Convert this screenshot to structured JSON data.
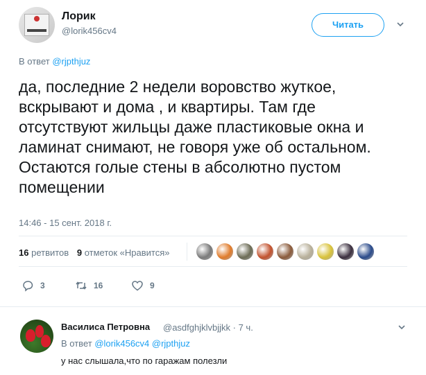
{
  "tweet": {
    "author_name": "Лорик",
    "author_handle": "@lorik456cv4",
    "follow_label": "Читать",
    "reply_prefix": "В ответ",
    "reply_handle": "@rjpthjuz",
    "text": "да, последние 2 недели воровство жуткое, вскрывают и дома , и квартиры. Там где отсутствуют жильцы даже пластиковые окна и ламинат снимают, не говоря  уже об остальном. Остаются голые стены в абсолютно пустом помещении",
    "date": "14:46 - 15 сент. 2018 г.",
    "retweet_count": "16",
    "retweet_label": "ретвитов",
    "like_count": "9",
    "like_label": "отметок «Нравится»",
    "likers": [
      {
        "icon": "avatar-geometric",
        "color": "#7a7a7a"
      },
      {
        "icon": "avatar-colorful",
        "color": "#e07b2a"
      },
      {
        "icon": "avatar-cat",
        "color": "#6b6b55"
      },
      {
        "icon": "avatar-orange",
        "color": "#c2512d"
      },
      {
        "icon": "avatar-photo",
        "color": "#8a5a3a"
      },
      {
        "icon": "avatar-map",
        "color": "#b8b09a"
      },
      {
        "icon": "avatar-yellow",
        "color": "#d8c23a"
      },
      {
        "icon": "avatar-dark",
        "color": "#3a2e3e"
      },
      {
        "icon": "avatar-blue",
        "color": "#2a4a8a"
      }
    ],
    "actions": {
      "reply_count": "3",
      "retweet_count": "16",
      "like_count": "9"
    }
  },
  "reply": {
    "author_name": "Василиса Петровна",
    "author_handle": "@asdfghjklvbjjkk",
    "time": "7 ч.",
    "reply_prefix": "В ответ",
    "reply_handles": "@lorik456cv4 @rjpthjuz",
    "text": "у нас слышала,что по гаражам полезли"
  },
  "colors": {
    "accent": "#1da1f2",
    "secondary_text": "#657786",
    "primary_text": "#14171a",
    "divider": "#e6ecf0"
  }
}
